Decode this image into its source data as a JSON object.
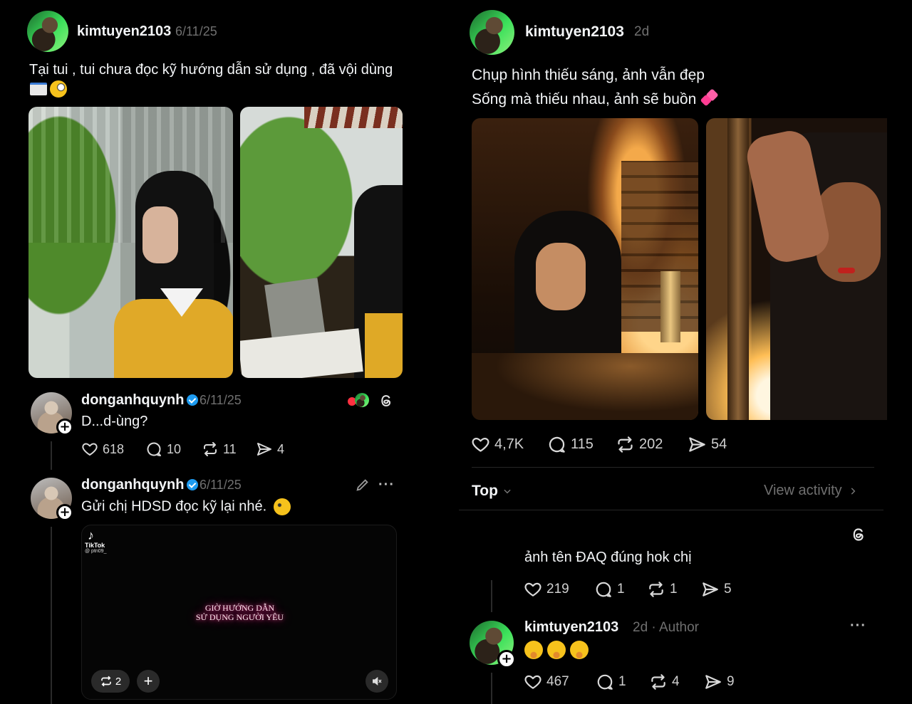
{
  "left_post": {
    "username": "kimtuyen2103",
    "date": "6/11/25",
    "caption": "Tại tui , tui chưa đọc kỹ hướng dẫn sử dụng , đã vội dùng"
  },
  "reply1": {
    "username": "donganhquynh",
    "date": "6/11/25",
    "text": "D...d-ùng?",
    "likes": "618",
    "comments": "10",
    "reposts": "11",
    "shares": "4"
  },
  "reply2": {
    "username": "donganhquynh",
    "date": "6/11/25",
    "text": "Gửi chị HDSD đọc kỹ lại nhé.",
    "video": {
      "brand": "TikTok",
      "handle": "@ ptn09_",
      "title_line1": "GIỜ HƯỚNG DẪN",
      "title_line2": "SỬ DỤNG NGƯỜI YÊU",
      "remix_count": "2"
    }
  },
  "right_post": {
    "username": "kimtuyen2103",
    "time": "2d",
    "caption_line1": "Chụp hình thiếu sáng, ảnh vẫn đẹp",
    "caption_line2": "Sống mà thiếu nhau, ảnh sẽ buồn",
    "likes": "4,7K",
    "comments": "115",
    "reposts": "202",
    "shares": "54"
  },
  "sort": {
    "label": "Top",
    "view_activity": "View activity"
  },
  "comment": {
    "text": "ảnh tên ĐAQ đúng hok chị",
    "likes": "219",
    "comments": "1",
    "reposts": "1",
    "shares": "5"
  },
  "author_reply": {
    "username": "kimtuyen2103",
    "time": "2d",
    "separator": "·",
    "author_label": "Author",
    "likes": "467",
    "comments": "1",
    "reposts": "4",
    "shares": "9"
  },
  "colors": {
    "background": "#000000",
    "text": "#f3f5f7",
    "muted": "#6f6f6f",
    "verified": "#1d9bf0"
  }
}
